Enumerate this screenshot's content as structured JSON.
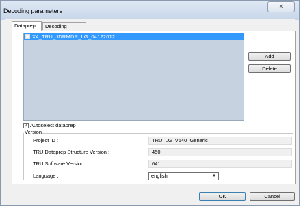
{
  "window": {
    "title": "Decoding parameters",
    "close_label": "✕"
  },
  "tabs": [
    {
      "label": "Dataprep",
      "active": true
    },
    {
      "label": "Decoding options",
      "active": false
    }
  ],
  "dataprep_list": {
    "items": [
      {
        "label": "X4_TRU_JDRMDR_LG_04122012",
        "selected": true
      }
    ]
  },
  "buttons": {
    "add": "Add",
    "delete": "Delete",
    "ok": "OK",
    "cancel": "Cancel"
  },
  "autoselect": {
    "label": "Autoselect dataprep",
    "checked": true,
    "check_mark": "✓"
  },
  "version": {
    "title": "Version",
    "rows": [
      {
        "label": "Project ID :",
        "value": "TRU_LG_V640_Generic"
      },
      {
        "label": "TRU Dataprep Structure Version :",
        "value": "450"
      },
      {
        "label": "TRU Software Version :",
        "value": "641"
      }
    ],
    "language": {
      "label": "Language :",
      "value": "english",
      "arrow": "▼"
    }
  }
}
